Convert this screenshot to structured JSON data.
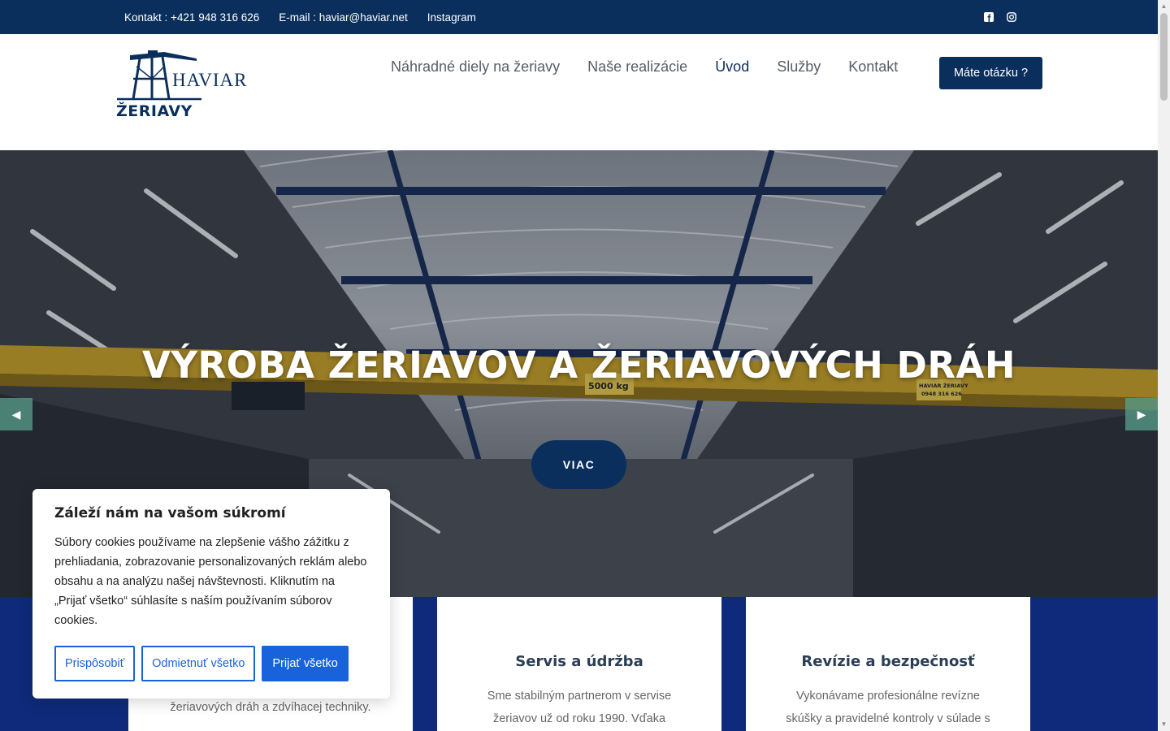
{
  "topbar": {
    "phone": "Kontakt : +421 948 316 626",
    "email": "E-mail : haviar@haviar.net",
    "instagram": "Instagram"
  },
  "header": {
    "logo_brand": "HAVIAR",
    "logo_sub": "ŽERIAVY",
    "nav": [
      "Náhradné diely na žeriavy",
      "Naše realizácie",
      "Úvod",
      "Služby",
      "Kontakt"
    ],
    "active_nav": "Úvod",
    "cta": "Máte otázku ?"
  },
  "hero": {
    "title": "VÝROBA ŽERIAVOV A ŽERIAVOVÝCH DRÁH",
    "button": "VIAC",
    "beam_label_1": "5000 kg",
    "beam_label_2": "HAVIAR ŽERIAVY",
    "beam_label_3": "0948 316 626"
  },
  "services": [
    {
      "title": "",
      "text": "žeriavových dráh a zdvíhacej techniky."
    },
    {
      "title": "Servis a údržba",
      "text": "Sme stabilným partnerom v servise žeriavov už od roku 1990. Vďaka"
    },
    {
      "title": "Revízie a bezpečnosť",
      "text": "Vykonávame profesionálne revízne skúšky a pravidelné kontroly v súlade s"
    }
  ],
  "cookie": {
    "title": "Záleží nám na vašom súkromí",
    "text": "Súbory cookies používame na zlepšenie vášho zážitku z prehliadania, zobrazovanie personalizovaných reklám alebo obsahu a na analýzu našej návštevnosti. Kliknutím na „Prijať všetko“ súhlasíte s naším používaním súborov cookies.",
    "customize": "Prispôsobiť",
    "reject": "Odmietnuť všetko",
    "accept": "Prijať všetko"
  },
  "colors": {
    "navy": "#0b2f5c",
    "band": "#0f2a7a",
    "cookie_blue": "#1863dc",
    "arrow": "#5aa08c"
  }
}
